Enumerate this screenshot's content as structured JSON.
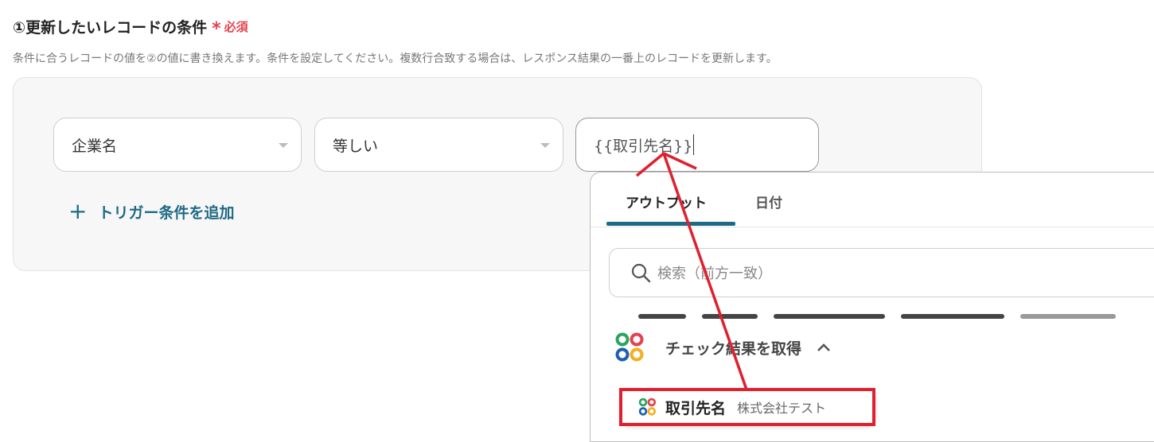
{
  "section": {
    "title": "①更新したいレコードの条件",
    "required_mark": "*",
    "required_label": "必須",
    "description": "条件に合うレコードの値を②の値に書き換えます。条件を設定してください。複数行合致する場合は、レスポンス結果の一番上のレコードを更新します。"
  },
  "condition": {
    "field_value": "企業名",
    "operator_value": "等しい",
    "input_value": "{{取引先名}}",
    "add_trigger_label": "トリガー条件を追加"
  },
  "dropdown": {
    "tabs": [
      {
        "label": "アウトプット",
        "active": true
      },
      {
        "label": "日付",
        "active": false
      }
    ],
    "search_placeholder": "検索（前方一致）",
    "group_label": "チェック結果を取得",
    "item": {
      "name": "取引先名",
      "value": "株式会社テスト"
    }
  },
  "colors": {
    "accent": "#1e6a85",
    "required": "#e5414f",
    "annotation": "#e0202e",
    "logo": [
      "#2aa55f",
      "#e5414f",
      "#1e5fae",
      "#f2b01e"
    ]
  }
}
